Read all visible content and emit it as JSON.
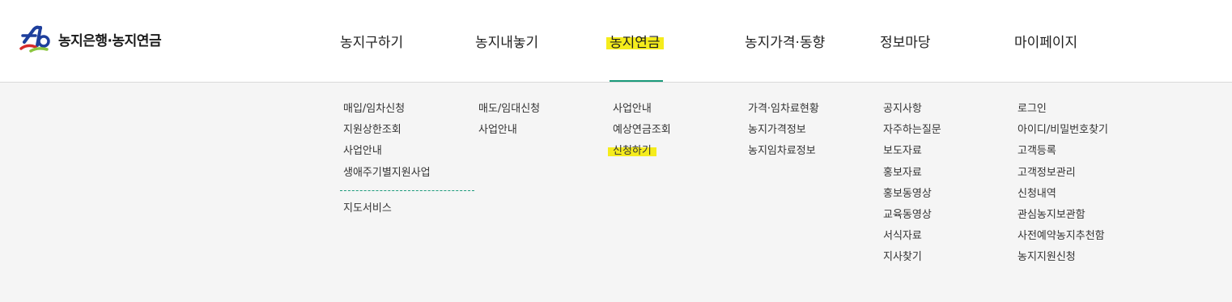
{
  "logo": {
    "text": "농지은행·농지연금"
  },
  "nav": [
    {
      "label": "농지구하기",
      "active": false
    },
    {
      "label": "농지내놓기",
      "active": false
    },
    {
      "label": "농지연금",
      "active": true
    },
    {
      "label": "농지가격·동향",
      "active": false
    },
    {
      "label": "정보마당",
      "active": false
    },
    {
      "label": "마이페이지",
      "active": false
    }
  ],
  "submenu": {
    "col1": [
      "매입/임차신청",
      "지원상한조회",
      "사업안내",
      "생애주기별지원사업"
    ],
    "col1_extra": [
      "지도서비스"
    ],
    "col2": [
      "매도/임대신청",
      "사업안내"
    ],
    "col3": [
      "사업안내",
      "예상연금조회",
      "신청하기"
    ],
    "col4": [
      "가격·임차료현황",
      "농지가격정보",
      "농지임차료정보"
    ],
    "col5": [
      "공지사항",
      "자주하는질문",
      "보도자료",
      "홍보자료",
      "홍보동영상",
      "교육동영상",
      "서식자료",
      "지사찾기"
    ],
    "col6": [
      "로그인",
      "아이디/비밀번호찾기",
      "고객등록",
      "고객정보관리",
      "신청내역",
      "관심농지보관함",
      "사전예약농지추천함",
      "농지지원신청"
    ]
  },
  "colors": {
    "accent": "#1a9a7a",
    "highlight": "#f5ec1c",
    "panel_bg": "#f5f5f5"
  }
}
